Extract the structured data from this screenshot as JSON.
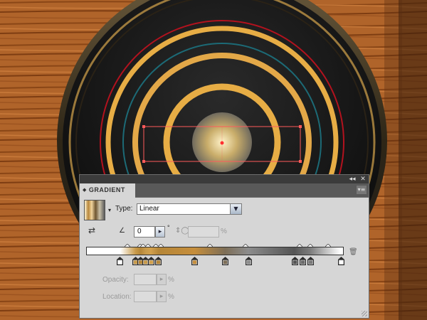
{
  "panel": {
    "tab_label": "GRADIENT",
    "tab_arrows": "◆",
    "collapse_icon": "◂◂",
    "close_icon": "✕",
    "menu_icon": "▾≡"
  },
  "type": {
    "label": "Type:",
    "value": "Linear"
  },
  "angle": {
    "value": "0",
    "unit": "°"
  },
  "aspect": {
    "value": "",
    "unit": "%"
  },
  "opacity": {
    "label": "Opacity:",
    "value": "",
    "unit": "%"
  },
  "location": {
    "label": "Location:",
    "value": "",
    "unit": "%"
  },
  "gradient": {
    "stops": [
      {
        "pos": 0.13,
        "color": "#ffffff"
      },
      {
        "pos": 0.19,
        "color": "#c89a4a"
      },
      {
        "pos": 0.21,
        "color": "#b58638"
      },
      {
        "pos": 0.23,
        "color": "#c89a4a"
      },
      {
        "pos": 0.25,
        "color": "#d2a04c"
      },
      {
        "pos": 0.28,
        "color": "#b58638"
      },
      {
        "pos": 0.42,
        "color": "#c68e3c"
      },
      {
        "pos": 0.54,
        "color": "#7d6e57"
      },
      {
        "pos": 0.63,
        "color": "#8c8c8c"
      },
      {
        "pos": 0.81,
        "color": "#545454"
      },
      {
        "pos": 0.84,
        "color": "#6a6a6a"
      },
      {
        "pos": 0.87,
        "color": "#7a7a7a"
      },
      {
        "pos": 0.99,
        "color": "#ffffff"
      }
    ],
    "midpoints": [
      0.16,
      0.21,
      0.22,
      0.24,
      0.27,
      0.29,
      0.48,
      0.62,
      0.83,
      0.87,
      0.94
    ]
  },
  "colors": {
    "wood_light": "#b5672b",
    "wood_dark": "#7e3d12",
    "disc": "#1b1b1b",
    "ring_gold": "#e7ad45",
    "ring_red": "#b3121e",
    "ring_teal": "#1c6a76",
    "selection": "#ff5a5a"
  }
}
